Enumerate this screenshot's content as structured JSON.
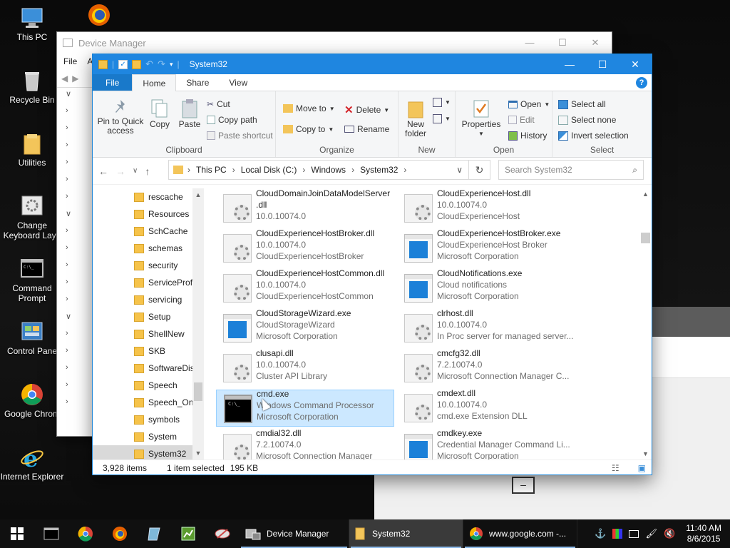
{
  "desktop": {
    "icons": [
      {
        "label": "This PC",
        "icon": "computer-icon"
      },
      {
        "label": "",
        "icon": "firefox-icon"
      },
      {
        "label": "Recycle Bin",
        "icon": "recycle-bin-icon"
      },
      {
        "label": "Utilities",
        "icon": "folder-icon"
      },
      {
        "label": "Change Keyboard Layo",
        "icon": "settings-icon"
      },
      {
        "label": "Command Prompt",
        "icon": "cmd-icon"
      },
      {
        "label": "Control Pane",
        "icon": "control-panel-icon"
      },
      {
        "label": "Google Chrom",
        "icon": "chrome-icon"
      },
      {
        "label": "Internet Explorer",
        "icon": "ie-icon"
      }
    ]
  },
  "device_manager": {
    "title": "Device Manager",
    "menu": [
      "File",
      "A"
    ]
  },
  "explorer": {
    "title": "System32",
    "tabs": {
      "file": "File",
      "home": "Home",
      "share": "Share",
      "view": "View"
    },
    "ribbon": {
      "clipboard": {
        "label": "Clipboard",
        "pin": "Pin to Quick access",
        "copy": "Copy",
        "paste": "Paste",
        "cut": "Cut",
        "copy_path": "Copy path",
        "paste_shortcut": "Paste shortcut"
      },
      "organize": {
        "label": "Organize",
        "move_to": "Move to",
        "copy_to": "Copy to",
        "delete": "Delete",
        "rename": "Rename"
      },
      "new": {
        "label": "New",
        "new_folder": "New folder"
      },
      "open": {
        "label": "Open",
        "properties": "Properties",
        "open": "Open",
        "edit": "Edit",
        "history": "History"
      },
      "select": {
        "label": "Select",
        "select_all": "Select all",
        "select_none": "Select none",
        "invert": "Invert selection"
      }
    },
    "address": {
      "crumbs": [
        "This PC",
        "Local Disk (C:)",
        "Windows",
        "System32"
      ],
      "search_placeholder": "Search System32"
    },
    "nav_items": [
      "rescache",
      "Resources",
      "SchCache",
      "schemas",
      "security",
      "ServiceProfi",
      "servicing",
      "Setup",
      "ShellNew",
      "SKB",
      "SoftwareDis",
      "Speech",
      "Speech_One",
      "symbols",
      "System",
      "System32"
    ],
    "nav_selected": "System32",
    "files_left": [
      {
        "name": "CloudDomainJoinDataModelServer",
        "name2": ".dll",
        "l2": "10.0.10074.0",
        "l3": "",
        "type": "dll"
      },
      {
        "name": "CloudExperienceHostBroker.dll",
        "l2": "10.0.10074.0",
        "l3": "CloudExperienceHostBroker",
        "type": "dll"
      },
      {
        "name": "CloudExperienceHostCommon.dll",
        "l2": "10.0.10074.0",
        "l3": "CloudExperienceHostCommon",
        "type": "dll"
      },
      {
        "name": "CloudStorageWizard.exe",
        "l2": "CloudStorageWizard",
        "l3": "Microsoft Corporation",
        "type": "exe"
      },
      {
        "name": "clusapi.dll",
        "l2": "10.0.10074.0",
        "l3": "Cluster API Library",
        "type": "dll"
      },
      {
        "name": "cmd.exe",
        "l2": "Windows Command Processor",
        "l3": "Microsoft Corporation",
        "type": "cmd"
      },
      {
        "name": "cmdial32.dll",
        "l2": "7.2.10074.0",
        "l3": "Microsoft Connection Manager",
        "type": "dll"
      }
    ],
    "files_right": [
      {
        "name": "CloudExperienceHost.dll",
        "l2": "10.0.10074.0",
        "l3": "CloudExperienceHost",
        "type": "dll"
      },
      {
        "name": "CloudExperienceHostBroker.exe",
        "l2": "CloudExperienceHost Broker",
        "l3": "Microsoft Corporation",
        "type": "exe"
      },
      {
        "name": "CloudNotifications.exe",
        "l2": "Cloud notifications",
        "l3": "Microsoft Corporation",
        "type": "exe"
      },
      {
        "name": "clrhost.dll",
        "l2": "10.0.10074.0",
        "l3": "In Proc server for managed server...",
        "type": "dll"
      },
      {
        "name": "cmcfg32.dll",
        "l2": "7.2.10074.0",
        "l3": "Microsoft Connection Manager C...",
        "type": "dll"
      },
      {
        "name": "cmdext.dll",
        "l2": "10.0.10074.0",
        "l3": "cmd.exe Extension DLL",
        "type": "dll"
      },
      {
        "name": "cmdkey.exe",
        "l2": "Credential Manager Command Li...",
        "l3": "Microsoft Corporation",
        "type": "exe"
      }
    ],
    "status": {
      "items": "3,928 items",
      "selected": "1 item selected",
      "size": "195 KB"
    }
  },
  "taskbar": {
    "buttons": [
      {
        "label": "Device Manager"
      },
      {
        "label": "System32"
      },
      {
        "label": "www.google.com -..."
      }
    ],
    "time": "11:40 AM",
    "date": "8/6/2015"
  }
}
